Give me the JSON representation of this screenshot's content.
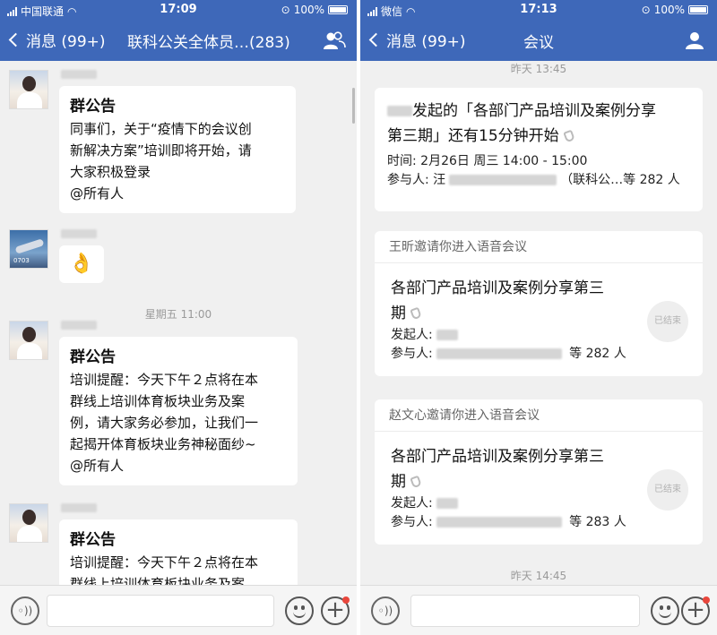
{
  "left": {
    "status": {
      "carrier": "中国联通",
      "time": "17:09",
      "battery": "100%"
    },
    "nav": {
      "back_label": "消息 (99+)",
      "title": "联科公关全体员…(283)",
      "icon": "group-members-icon"
    },
    "messages": [
      {
        "title": "群公告",
        "lines": [
          "同事们，关于“疫情下的会议创",
          "新解决方案”培训即将开始，请",
          "大家积极登录",
          "@所有人"
        ]
      },
      {
        "emoji": "👌"
      },
      {
        "title": "群公告",
        "lines": [
          "培训提醒：今天下午２点将在本",
          "群线上培训体育板块业务及案",
          "例，请大家务必参加，让我们一",
          "起揭开体育板块业务神秘面纱~",
          "@所有人"
        ]
      },
      {
        "title": "群公告",
        "lines": [
          "培训提醒：今天下午２点将在本",
          "群线上培训体育板块业务及案"
        ]
      }
    ],
    "timestamp": "星期五 11:00",
    "avatar_jet_text": "0703"
  },
  "right": {
    "status": {
      "carrier": "微信",
      "time": "17:13",
      "battery": "100%"
    },
    "nav": {
      "back_label": "消息 (99+)",
      "title": "会议",
      "icon": "profile-icon"
    },
    "timestamp_top": "昨天 13:45",
    "reminder": {
      "title_suffix": "发起的「各部门产品培训及案例分享",
      "title_line2": "第三期」还有15分钟开始",
      "time": "时间: 2月26日 周三 14:00 - 15:00",
      "participants_prefix": "参与人: 汪",
      "participants_suffix": "（联科公…等 282 人"
    },
    "invites": [
      {
        "inviter": "王昕邀请你进入语音会议",
        "title1": "各部门产品培训及案例分享第三",
        "title2": "期",
        "initiator_label": "发起人:",
        "participants_label": "参与人:",
        "participants_count": "等 282 人",
        "status": "已结束"
      },
      {
        "inviter": "赵文心邀请你进入语音会议",
        "title1": "各部门产品培训及案例分享第三",
        "title2": "期",
        "initiator_label": "发起人:",
        "participants_label": "参与人:",
        "participants_count": "等 283 人",
        "status": "已结束"
      }
    ],
    "timestamp_bottom": "昨天 14:45"
  },
  "colors": {
    "nav_bg": "#3e68b9",
    "chat_bg": "#f0f0f0",
    "bubble_bg": "#ffffff",
    "badge_dot": "#e8463c"
  }
}
